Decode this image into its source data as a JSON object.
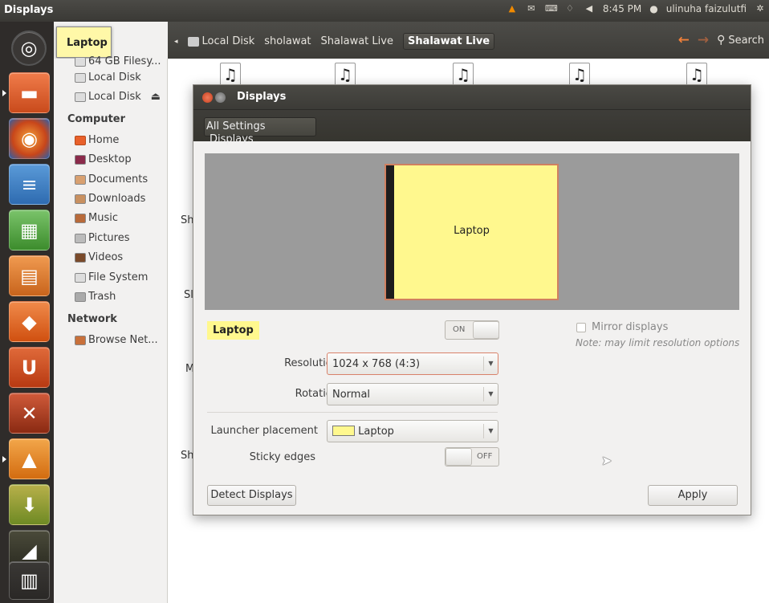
{
  "topbar": {
    "app_name": "Displays",
    "time": "8:45 PM",
    "user": "ulinuha faizulutfi",
    "indicators": [
      "vlc-tray-icon",
      "mail-icon",
      "keyboard-icon",
      "network-icon",
      "volume-icon",
      "session-gear-icon"
    ]
  },
  "launcher": {
    "tooltip": "Laptop",
    "items": [
      "ubuntu-dash-icon",
      "files-icon",
      "firefox-icon",
      "writer-icon",
      "calc-icon",
      "impress-icon",
      "software-center-icon",
      "ubuntu-one-icon",
      "system-settings-icon",
      "vlc-icon",
      "downloader-icon",
      "workspace-icon",
      "trash-icon"
    ]
  },
  "fm": {
    "breadcrumbs": [
      "Local Disk",
      "sholawat",
      "Shalawat Live",
      "Shalawat Live"
    ],
    "search_label": "Search",
    "sidebar": {
      "devices_fragment": "64 GB Filesy...",
      "devices": [
        "Local Disk",
        "Local Disk"
      ],
      "computer_header": "Computer",
      "computer": [
        "Home",
        "Desktop",
        "Documents",
        "Downloads",
        "Music",
        "Pictures",
        "Videos",
        "File System",
        "Trash"
      ],
      "network_header": "Network",
      "network": [
        "Browse Net..."
      ]
    },
    "behind_fragments": [
      "Sh",
      "Sl",
      "M",
      "Sh"
    ]
  },
  "dialog": {
    "title": "Displays",
    "toolbar": {
      "all_settings": "All Settings",
      "current": "Displays"
    },
    "monitor_label": "Laptop",
    "display_name": "Laptop",
    "power_switch": "ON",
    "mirror_label": "Mirror displays",
    "mirror_note": "Note: may limit resolution options",
    "resolution_label": "Resolution",
    "resolution_value": "1024 x 768 (4:3)",
    "rotation_label": "Rotation",
    "rotation_value": "Normal",
    "launcher_label": "Launcher placement",
    "launcher_value": "Laptop",
    "sticky_label": "Sticky edges",
    "sticky_switch": "OFF",
    "detect_button": "Detect Displays",
    "apply_button": "Apply"
  }
}
